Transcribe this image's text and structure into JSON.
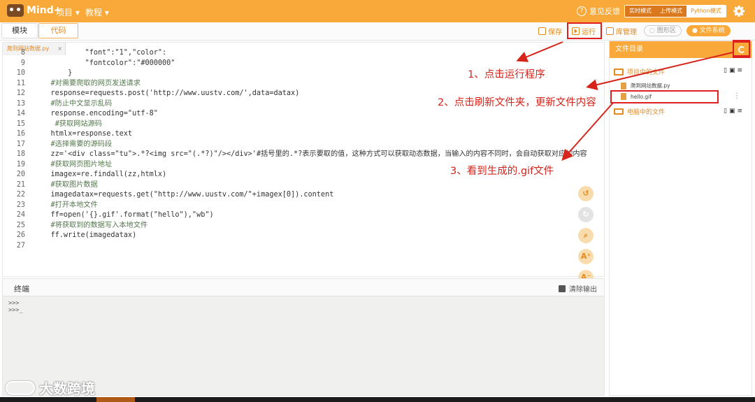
{
  "app": {
    "logo_text": "Mind+",
    "menu_project": "项目",
    "menu_tutorial": "教程",
    "feedback": "意见反馈",
    "modes": [
      "实时模式",
      "上传模式",
      "Python模式"
    ]
  },
  "tabs": {
    "blocks": "模块",
    "code": "代码"
  },
  "toolbar": {
    "save": "保存",
    "run": "运行",
    "lib_manage": "库管理",
    "graphics": "图形区",
    "file_system": "文件系统"
  },
  "editor": {
    "file_tab": "爬到网站数据.py",
    "file_tab_close": "×",
    "lines": [
      {
        "n": "8",
        "t": "            \"font\":\"1\",\"color\":"
      },
      {
        "n": "9",
        "t": "            \"fontcolor\":\"#000000\""
      },
      {
        "n": "10",
        "t": "        }"
      },
      {
        "n": "11",
        "t": "    #对需要爬取的网页发送请求"
      },
      {
        "n": "12",
        "t": "    response=requests.post('http://www.uustv.com/',data=datax)"
      },
      {
        "n": "13",
        "t": "    #防止中文显示乱码"
      },
      {
        "n": "14",
        "t": "    response.encoding=\"utf-8\""
      },
      {
        "n": "15",
        "t": "     #获取网站源码"
      },
      {
        "n": "16",
        "t": "    htmlx=response.text"
      },
      {
        "n": "17",
        "t": "    #选择需要的源码段"
      },
      {
        "n": "18",
        "t": "    zz='<div class=\"tu\">.*?<img src=\"(.*?)\"/></div>'#括号里的.*?表示要取的值，这种方式可以获取动态数据，当输入的内容不同时，会自动获取对应的内容"
      },
      {
        "n": "19",
        "t": "    #获取网页图片地址"
      },
      {
        "n": "20",
        "t": "    imagex=re.findall(zz,htmlx)"
      },
      {
        "n": "21",
        "t": "    #获取图片数据"
      },
      {
        "n": "22",
        "t": "    imagedatax=requests.get(\"http://www.uustv.com/\"+imagex[0]).content"
      },
      {
        "n": "23",
        "t": "    #打开本地文件"
      },
      {
        "n": "24",
        "t": "    ff=open('{}.gif'.format(\"hello\"),\"wb\")"
      },
      {
        "n": "25",
        "t": "    #将获取到的数据写入本地文件"
      },
      {
        "n": "26",
        "t": "    ff.write(imagedatax)"
      },
      {
        "n": "27",
        "t": ""
      }
    ]
  },
  "terminal": {
    "title": "终端",
    "clear": "清除输出",
    "output": [
      ">>>",
      ">>>_"
    ]
  },
  "files_panel": {
    "title": "文件目录",
    "project_folder": "项目中的文件",
    "project_files": [
      "爬到网站数据.py",
      "hello.gif"
    ],
    "computer_folder": "电脑中的文件"
  },
  "annotations": {
    "a1": "1、点击运行程序",
    "a2": "2、点击刷新文件夹，更新文件内容",
    "a3": "3、看到生成的.gif文件"
  },
  "watermark": "大数跨境",
  "colors": {
    "brand": "#f8a93a",
    "annotation": "#d6241b"
  }
}
